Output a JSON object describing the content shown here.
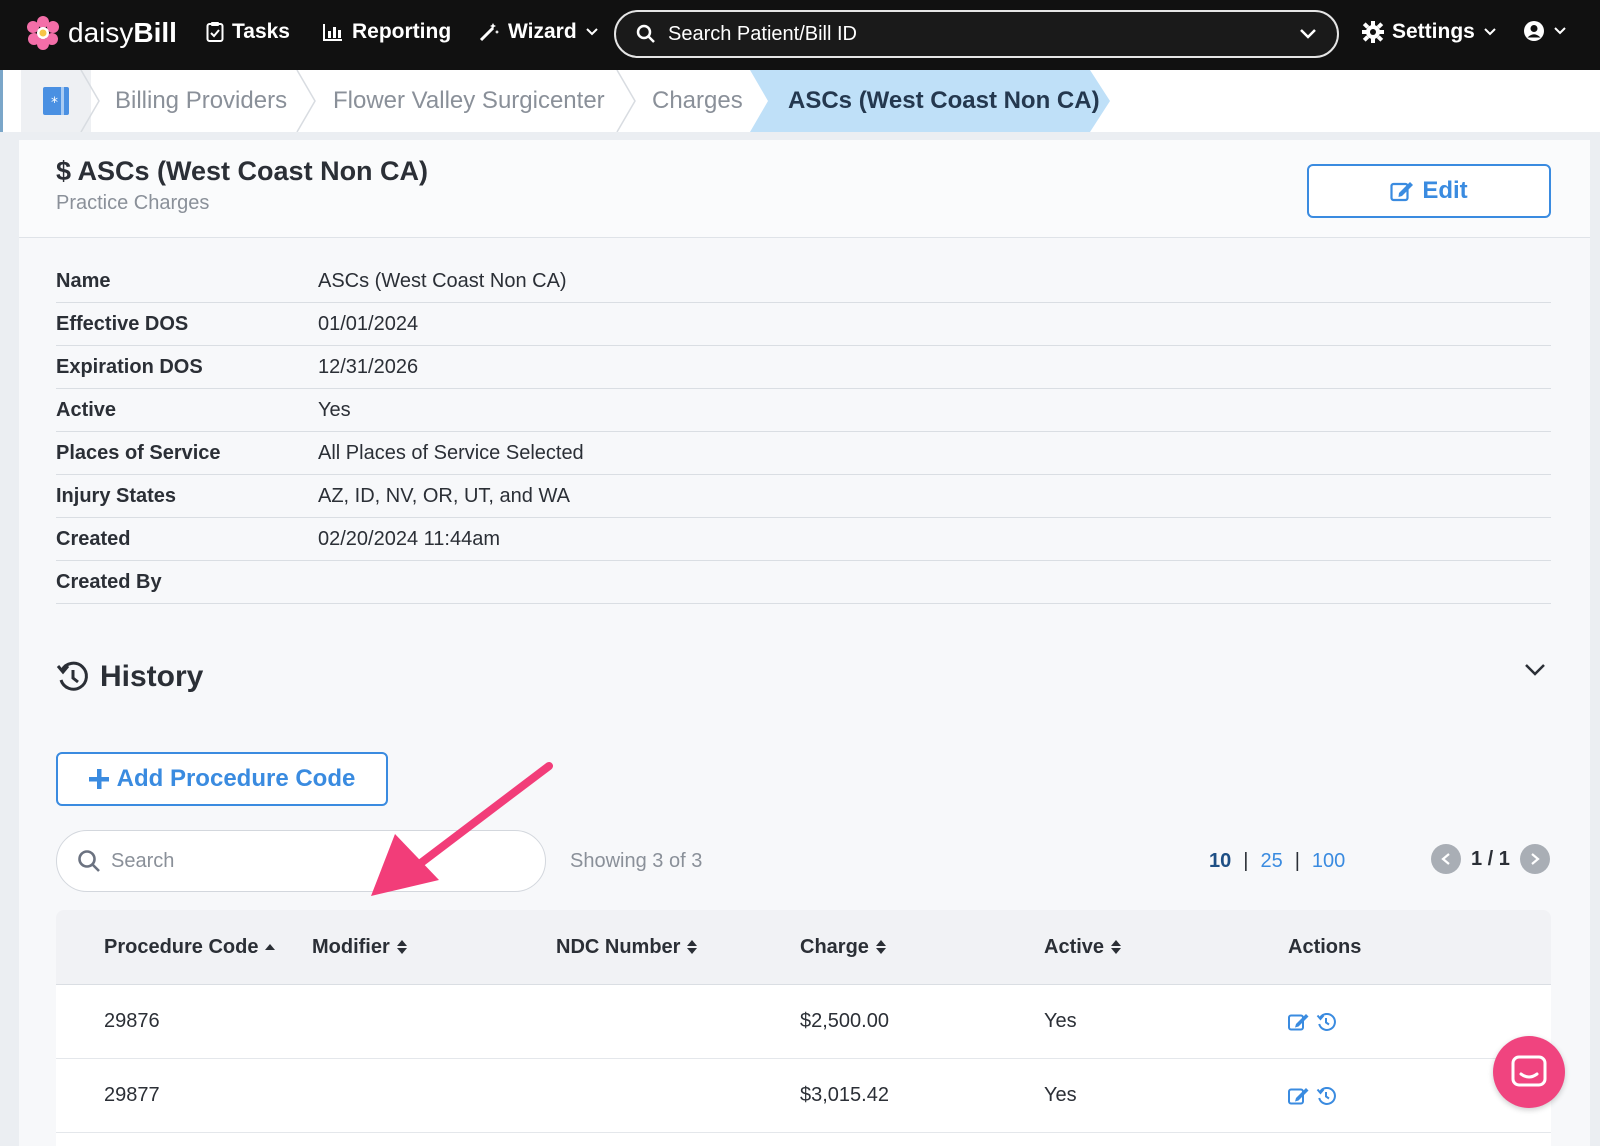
{
  "nav": {
    "brand_prefix": "daisy",
    "brand_suffix": "Bill",
    "tasks": "Tasks",
    "reporting": "Reporting",
    "wizard": "Wizard",
    "search_placeholder": "Search Patient/Bill ID",
    "settings": "Settings"
  },
  "breadcrumb": {
    "items": [
      "Billing Providers",
      "Flower Valley Surgicenter",
      "Charges"
    ],
    "active": "ASCs (West Coast Non CA)"
  },
  "header": {
    "title": "$ ASCs (West Coast Non CA)",
    "subtitle": "Practice Charges",
    "edit_label": "Edit"
  },
  "details": [
    {
      "label": "Name",
      "value": "ASCs (West Coast Non CA)"
    },
    {
      "label": "Effective DOS",
      "value": "01/01/2024"
    },
    {
      "label": "Expiration DOS",
      "value": "12/31/2026"
    },
    {
      "label": "Active",
      "value": "Yes"
    },
    {
      "label": "Places of Service",
      "value": "All Places of Service Selected"
    },
    {
      "label": "Injury States",
      "value": "AZ, ID, NV, OR, UT, and WA"
    },
    {
      "label": "Created",
      "value": "02/20/2024 11:44am"
    },
    {
      "label": "Created By",
      "value": ""
    }
  ],
  "history": {
    "title": "History",
    "add_label": "Add Procedure Code"
  },
  "table_controls": {
    "search_placeholder": "Search",
    "showing": "Showing 3 of 3",
    "page_sizes": [
      "10",
      "25",
      "100"
    ],
    "selected_page_size": "10",
    "page": "1 / 1"
  },
  "table": {
    "columns": [
      "Procedure Code",
      "Modifier",
      "NDC Number",
      "Charge",
      "Active",
      "Actions"
    ],
    "rows": [
      {
        "code": "29876",
        "modifier": "",
        "ndc": "",
        "charge": "$2,500.00",
        "active": "Yes"
      },
      {
        "code": "29877",
        "modifier": "",
        "ndc": "",
        "charge": "$3,015.42",
        "active": "Yes"
      }
    ]
  },
  "colors": {
    "accent": "#3a8be0",
    "annotation_arrow": "#f23d79",
    "chat": "#f0447f",
    "nav_bg": "#111111"
  }
}
